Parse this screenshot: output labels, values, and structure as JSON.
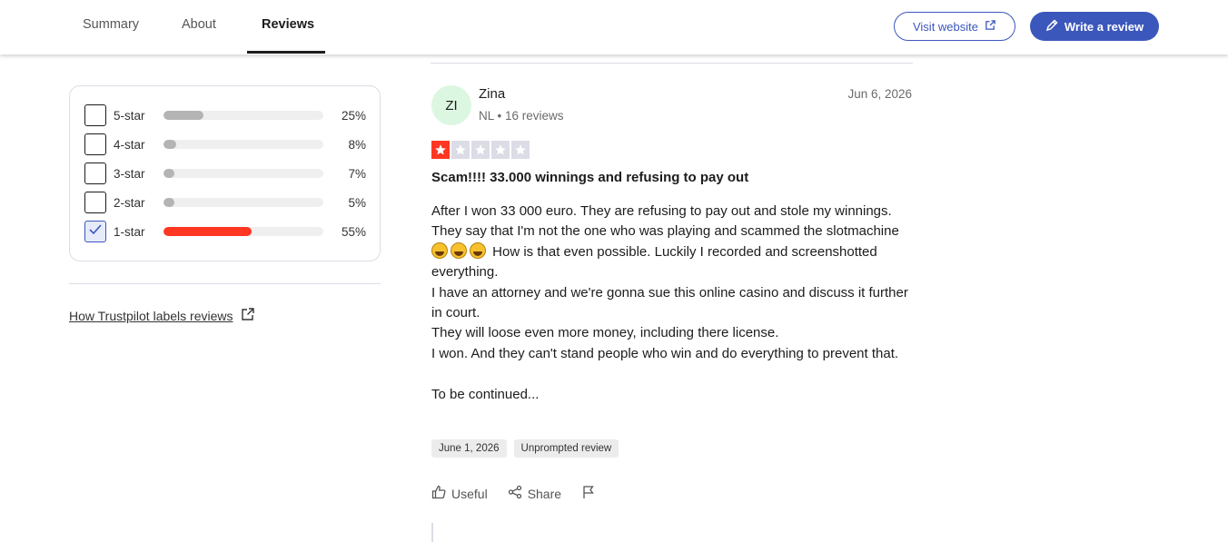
{
  "nav": {
    "tabs": [
      {
        "label": "Summary"
      },
      {
        "label": "About"
      },
      {
        "label": "Reviews",
        "active": true
      }
    ],
    "visit_website": "Visit website",
    "write_review": "Write a review",
    "accent_color": "#3c57bc"
  },
  "filters": {
    "rows": [
      {
        "label": "5-star",
        "percent": "25%",
        "fill": 0.25,
        "checked": false
      },
      {
        "label": "4-star",
        "percent": "8%",
        "fill": 0.08,
        "checked": false
      },
      {
        "label": "3-star",
        "percent": "7%",
        "fill": 0.07,
        "checked": false
      },
      {
        "label": "2-star",
        "percent": "5%",
        "fill": 0.05,
        "checked": false
      },
      {
        "label": "1-star",
        "percent": "55%",
        "fill": 0.55,
        "checked": true
      }
    ],
    "labels_link": "How Trustpilot labels reviews"
  },
  "review": {
    "initials": "ZI",
    "name": "Zina",
    "meta": "NL • 16 reviews",
    "date": "Jun 6, 2026",
    "rating": 1,
    "title": "Scam!!!! 33.000 winnings and refusing to pay out",
    "body_line1": "After I won 33 000 euro. They are refusing to pay out and stole my winnings. They say that I'm not the one who was playing and scammed the slotmachine",
    "body_line1_tail": "How is that even possible. Luckily I recorded and screenshotted everything.",
    "body_line2": "I have an attorney and we're gonna sue this online casino and discuss it further in court.",
    "body_line3": "They will loose even more money, including there license.",
    "body_line4": "I won. And they can't stand people who win and do everything to prevent that.",
    "body_line5": "To be continued...",
    "experience_date": "June 1, 2026",
    "tag": "Unprompted review",
    "useful": "Useful",
    "share": "Share",
    "star_color": "#ff3722"
  }
}
